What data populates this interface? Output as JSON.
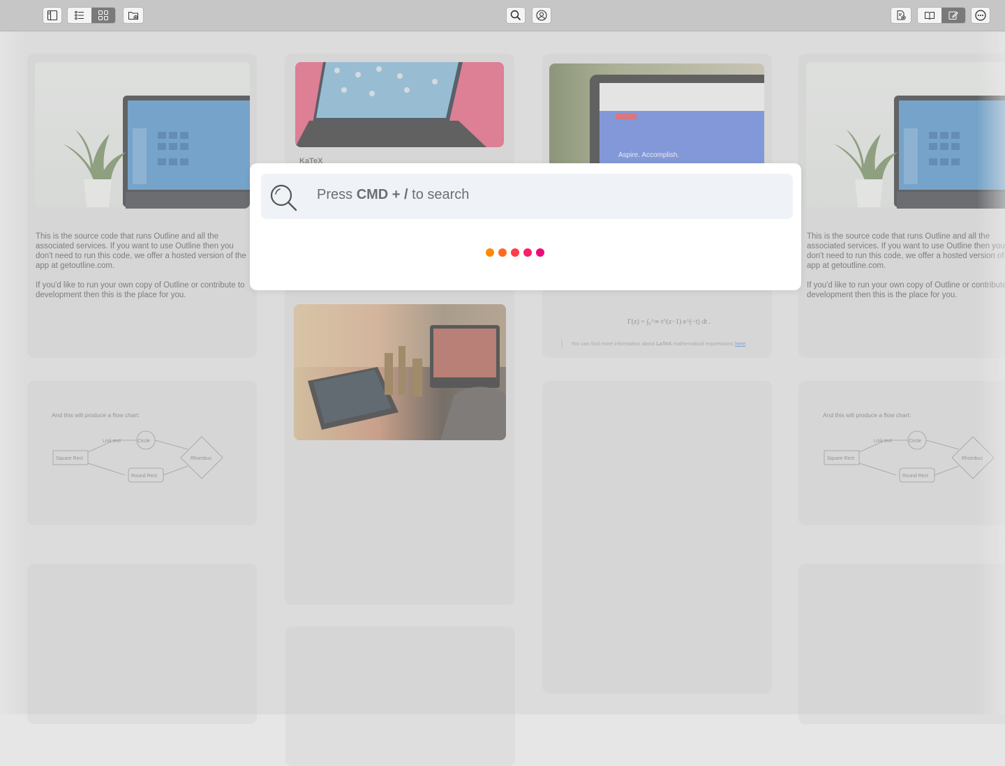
{
  "toolbar": {
    "left_buttons": [
      "sidebar-toggle",
      "list-view",
      "grid-view",
      "new-folder"
    ],
    "active_view": "grid-view",
    "center_buttons": [
      "search",
      "account"
    ],
    "right_buttons": [
      "new-document",
      "read-mode",
      "edit-mode",
      "more"
    ],
    "active_mode": "edit-mode"
  },
  "cards": {
    "outline_intro_p1": "This is the source code that runs Outline and all the associated services. If you want to use Outline then you don't need to run this code, we offer a hosted version of the app at getoutline.com.",
    "outline_intro_p2": "If you'd like to run your own copy of Outline or contribute to development then this is the place for you.",
    "katex_title": "KaTeX",
    "browser_banner": "Aspire. Accomplish.",
    "formula": "Γ(z) = ∫₀^∞ t^(z−1) e^(−t) dt .",
    "katex_note_prefix": "You can find more information about",
    "katex_note_bold": "LaTeX",
    "katex_note_mid": "mathematical expressions",
    "katex_note_link": "here",
    "flowchart_caption": "And this will produce a flow chart:",
    "flow_link_text": "Link text",
    "flow_circle": "Circle",
    "flow_square": "Square Rect",
    "flow_rhombus": "Rhombus",
    "flow_round": "Round Rect"
  },
  "search": {
    "prefix": "Press ",
    "shortcut": "CMD + /",
    "suffix": " to search"
  },
  "colors": {
    "toolbar_bg": "#c6c6c6",
    "loader": [
      "#ff8a00",
      "#ff6a20",
      "#ff3d4a",
      "#f7206a",
      "#ee0a7a"
    ]
  }
}
